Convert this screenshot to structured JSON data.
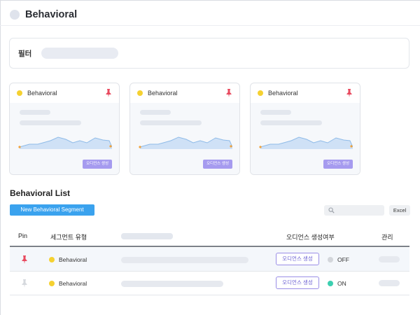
{
  "header": {
    "title": "Behavioral"
  },
  "filter": {
    "label": "필터"
  },
  "cards": [
    {
      "name": "Behavioral",
      "button_label": "오디언스 생성"
    },
    {
      "name": "Behavioral",
      "button_label": "오디언스 생성"
    },
    {
      "name": "Behavioral",
      "button_label": "오디언스 생성"
    }
  ],
  "list": {
    "title": "Behavioral List",
    "new_button": "New Behavioral Segment",
    "excel_label": "Excel",
    "columns": {
      "pin": "Pin",
      "type": "세그먼트 유형",
      "audience": "오디언스 생성여부",
      "manage": "관리"
    },
    "rows": [
      {
        "pinned": true,
        "type": "Behavioral",
        "audience_button": "오디언스 생성",
        "status": "OFF"
      },
      {
        "pinned": false,
        "type": "Behavioral",
        "audience_button": "오디언스 생성",
        "status": "ON"
      }
    ]
  },
  "colors": {
    "accent_blue": "#3aa2ee",
    "purple": "#a69bef",
    "pin_red": "#e84a5f",
    "status_on": "#3ccfb0",
    "status_off": "#d3d6db",
    "type_dot": "#f5d131"
  },
  "icons": {
    "pin": "pushpin-icon",
    "search": "search-icon"
  }
}
